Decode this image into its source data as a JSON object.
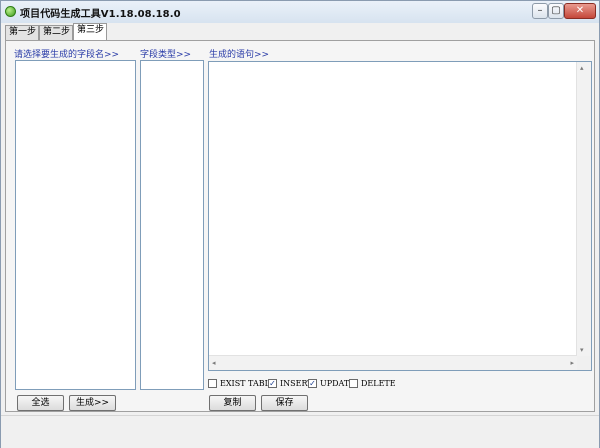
{
  "window": {
    "title": "项目代码生成工具V1.18.08.18.0",
    "controls": {
      "minimize": "–",
      "maximize": "▢",
      "close": "✕"
    }
  },
  "tabs": [
    {
      "label": "第一步",
      "active": false
    },
    {
      "label": "第二步",
      "active": false
    },
    {
      "label": "第三步",
      "active": true
    }
  ],
  "fields_panel": {
    "label": "请选择要生成的字段名>>"
  },
  "types_panel": {
    "label": "字段类型>>"
  },
  "output_panel": {
    "label": "生成的语句>>",
    "value": ""
  },
  "buttons": {
    "select_all": "全选",
    "generate": "生成>>",
    "copy": "复制",
    "save": "保存"
  },
  "options": [
    {
      "label": "EXIST TABLE",
      "checked": false
    },
    {
      "label": "INSERT",
      "checked": true
    },
    {
      "label": "UPDATE",
      "checked": true
    },
    {
      "label": "DELETE",
      "checked": false
    }
  ],
  "icons": {
    "app": "green-orb-icon",
    "scroll_up": "▴",
    "scroll_down": "▾",
    "scroll_left": "◂",
    "scroll_right": "▸",
    "check": "✓"
  }
}
